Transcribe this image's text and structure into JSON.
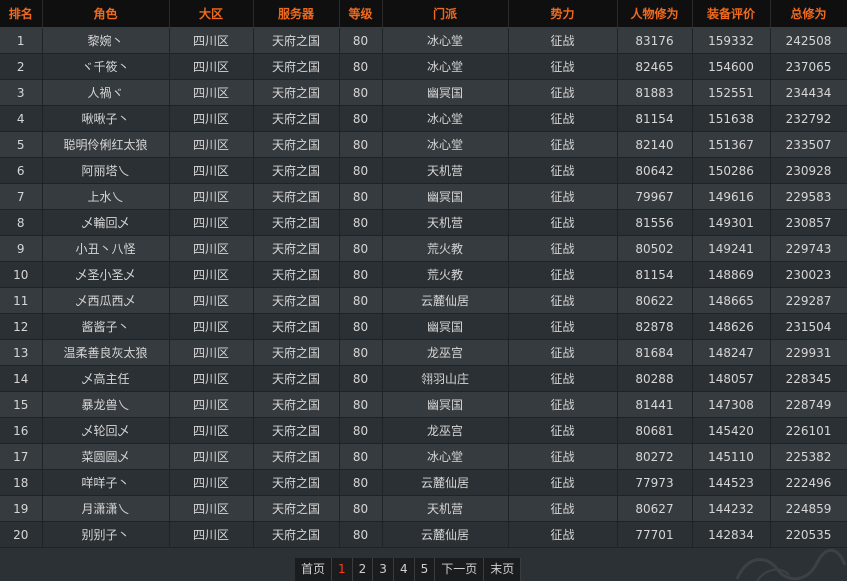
{
  "headers": [
    "排名",
    "角色",
    "大区",
    "服务器",
    "等级",
    "门派",
    "势力",
    "人物修为",
    "装备评价",
    "总修为"
  ],
  "rows": [
    [
      "1",
      "黎婉丶",
      "四川区",
      "天府之国",
      "80",
      "冰心堂",
      "征战",
      "83176",
      "159332",
      "242508"
    ],
    [
      "2",
      "ヾ千筱丶",
      "四川区",
      "天府之国",
      "80",
      "冰心堂",
      "征战",
      "82465",
      "154600",
      "237065"
    ],
    [
      "3",
      "人禍ヾ",
      "四川区",
      "天府之国",
      "80",
      "幽冥国",
      "征战",
      "81883",
      "152551",
      "234434"
    ],
    [
      "4",
      "啾啾子丶",
      "四川区",
      "天府之国",
      "80",
      "冰心堂",
      "征战",
      "81154",
      "151638",
      "232792"
    ],
    [
      "5",
      "聪明伶俐红太狼",
      "四川区",
      "天府之国",
      "80",
      "冰心堂",
      "征战",
      "82140",
      "151367",
      "233507"
    ],
    [
      "6",
      "阿丽塔乀",
      "四川区",
      "天府之国",
      "80",
      "天机营",
      "征战",
      "80642",
      "150286",
      "230928"
    ],
    [
      "7",
      "上水乀",
      "四川区",
      "天府之国",
      "80",
      "幽冥国",
      "征战",
      "79967",
      "149616",
      "229583"
    ],
    [
      "8",
      "乄輪回乄",
      "四川区",
      "天府之国",
      "80",
      "天机营",
      "征战",
      "81556",
      "149301",
      "230857"
    ],
    [
      "9",
      "小丑丶八怪",
      "四川区",
      "天府之国",
      "80",
      "荒火教",
      "征战",
      "80502",
      "149241",
      "229743"
    ],
    [
      "10",
      "乄圣小圣乄",
      "四川区",
      "天府之国",
      "80",
      "荒火教",
      "征战",
      "81154",
      "148869",
      "230023"
    ],
    [
      "11",
      "乄西瓜西乄",
      "四川区",
      "天府之国",
      "80",
      "云麓仙居",
      "征战",
      "80622",
      "148665",
      "229287"
    ],
    [
      "12",
      "酱酱子丶",
      "四川区",
      "天府之国",
      "80",
      "幽冥国",
      "征战",
      "82878",
      "148626",
      "231504"
    ],
    [
      "13",
      "温柔善良灰太狼",
      "四川区",
      "天府之国",
      "80",
      "龙巫宫",
      "征战",
      "81684",
      "148247",
      "229931"
    ],
    [
      "14",
      "乄高主任",
      "四川区",
      "天府之国",
      "80",
      "翎羽山庄",
      "征战",
      "80288",
      "148057",
      "228345"
    ],
    [
      "15",
      "暴龙兽乀",
      "四川区",
      "天府之国",
      "80",
      "幽冥国",
      "征战",
      "81441",
      "147308",
      "228749"
    ],
    [
      "16",
      "乄轮回乄",
      "四川区",
      "天府之国",
      "80",
      "龙巫宫",
      "征战",
      "80681",
      "145420",
      "226101"
    ],
    [
      "17",
      "菜圆圆乄",
      "四川区",
      "天府之国",
      "80",
      "冰心堂",
      "征战",
      "80272",
      "145110",
      "225382"
    ],
    [
      "18",
      "咩咩子丶",
      "四川区",
      "天府之国",
      "80",
      "云麓仙居",
      "征战",
      "77973",
      "144523",
      "222496"
    ],
    [
      "19",
      "月潇潇乀",
      "四川区",
      "天府之国",
      "80",
      "天机营",
      "征战",
      "80627",
      "144232",
      "224859"
    ],
    [
      "20",
      "别别子丶",
      "四川区",
      "天府之国",
      "80",
      "云麓仙居",
      "征战",
      "77701",
      "142834",
      "220535"
    ]
  ],
  "pagination": {
    "first": "首页",
    "pages": [
      "1",
      "2",
      "3",
      "4",
      "5"
    ],
    "current": "1",
    "next": "下一页",
    "last": "末页"
  },
  "colors": {
    "header_text": "#ee6a1e",
    "current_page": "#ff3b1e"
  }
}
